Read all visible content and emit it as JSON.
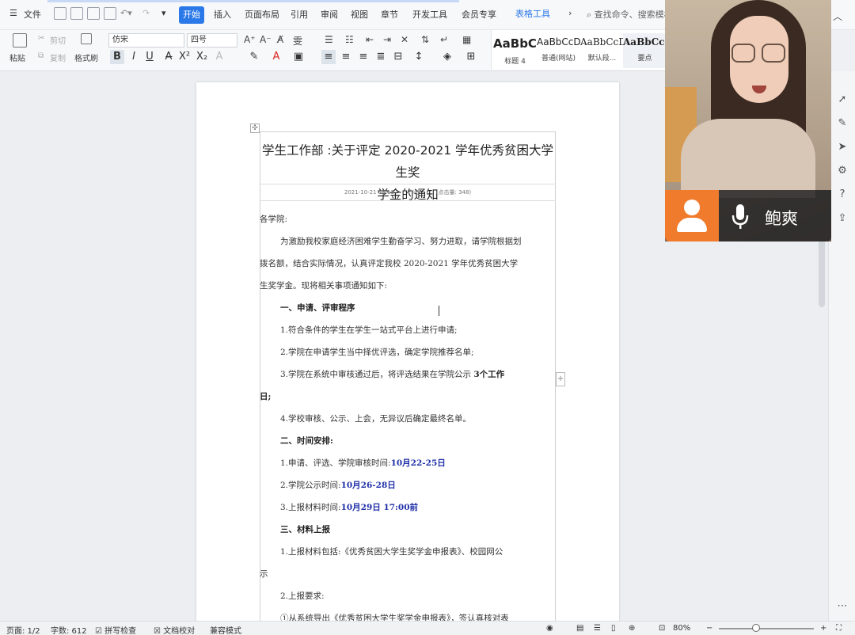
{
  "menubar": {
    "file_label": "文件",
    "tabs": [
      "开始",
      "插入",
      "页面布局",
      "引用",
      "审阅",
      "视图",
      "章节",
      "开发工具",
      "会员专享"
    ],
    "table_tools_label": "表格工具",
    "search_placeholder": "查找命令、搜索模板"
  },
  "toolbar": {
    "paste_label": "粘贴",
    "cut_label": "剪切",
    "copy_label": "复制",
    "format_painter_label": "格式刷",
    "font_name": "仿宋",
    "font_size": "四号",
    "styles": [
      {
        "sample": "AaBbC",
        "name": "标题 4"
      },
      {
        "sample": "AaBbCcD",
        "name": "普通(网站)"
      },
      {
        "sample": "AaBbCcDd",
        "name": "默认段..."
      },
      {
        "sample": "AaBbCcDd",
        "name": "要点"
      }
    ]
  },
  "document": {
    "title_line1": "学生工作部 :关于评定 2020-2021 学年优秀贫困大学生奖",
    "title_line2": "学金的通知",
    "meta_date": "2021-10-21 15:13",
    "meta_author": "作者:",
    "meta_views": "(点击量: 348)",
    "salutation": "各学院:",
    "intro_1": "为激励我校家庭经济困难学生勤奋学习、努力进取，请学院根据划",
    "intro_2": "拨名额，结合实际情况，认真评定我校 2020-2021 学年优秀贫困大学",
    "intro_3": "生奖学金。现将相关事项通知如下:",
    "heading_1": "一、申请、评审程序",
    "step_1": "1.符合条件的学生在学生一站式平台上进行申请;",
    "step_2": "2.学院在申请学生当中择优评选，确定学院推荐名单;",
    "step_3_a": "3.学院在系统中审核通过后，将评选结果在学院公示",
    "step_3_bold": "3个工作",
    "step_3_b": "日;",
    "step_4": "4.学校审核、公示、上会，无异议后确定最终名单。",
    "heading_2": "二、时间安排:",
    "time_1_label": "1.申请、评选、学院审核时间:",
    "time_1_value": "10月22-25日",
    "time_2_label": "2.学院公示时间:",
    "time_2_value": "10月26-28日",
    "time_3_label": "3.上报材料时间:",
    "time_3_value": "10月29日 17:00前",
    "heading_3": "三、材料上报",
    "material_1_a": "1.上报材料包括:《优秀贫困大学生奖学金申报表》、校园网公",
    "material_1_b": "示",
    "material_2": "2.上报要求:",
    "material_2_item": "①从系统导出《优秀贫困大学生奖学金申报表》，签认真核对表"
  },
  "video": {
    "speaker_name": "鲍爽"
  },
  "statusbar": {
    "page": "页面: 1/2",
    "word_count": "字数: 612",
    "spell_check": "拼写检查",
    "doc_proof": "文档校对",
    "compat_mode": "兼容模式",
    "zoom": "80%"
  },
  "colors": {
    "accent": "#2b79e8",
    "highlight_blue": "#2030a8",
    "avatar_orange": "#f07b2c"
  }
}
